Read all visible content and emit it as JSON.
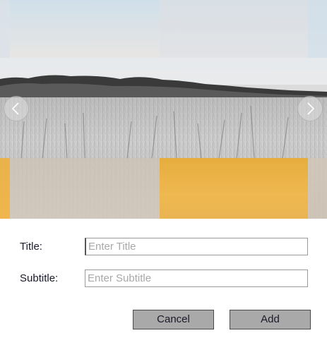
{
  "carousel": {
    "prev_icon": "chevron-left-icon",
    "next_icon": "chevron-right-icon",
    "image_subject": "wheat-field-photo"
  },
  "form": {
    "title_label": "Title:",
    "title_placeholder": "Enter Title",
    "title_value": "",
    "subtitle_label": "Subtitle:",
    "subtitle_placeholder": "Enter Subtitle",
    "subtitle_value": ""
  },
  "buttons": {
    "cancel_label": "Cancel",
    "add_label": "Add"
  },
  "colors": {
    "button_bg": "#a9a9a9",
    "button_border": "#4a4a4a",
    "label_text": "#1a1a2a",
    "placeholder_text": "#a8a8a8",
    "accent_gold": "#efb850"
  }
}
